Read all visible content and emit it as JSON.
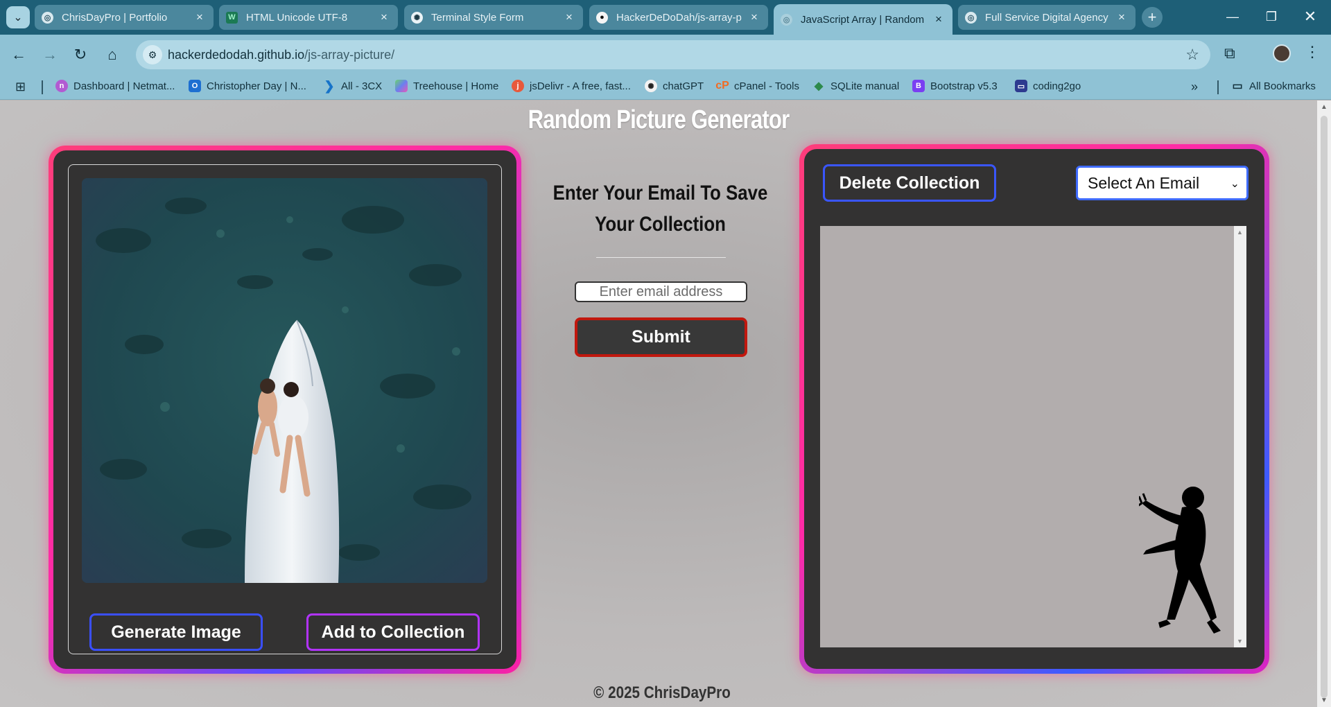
{
  "browser": {
    "tabs": [
      {
        "title": "ChrisDayPro | Portfolio",
        "active": false
      },
      {
        "title": "HTML Unicode UTF-8",
        "active": false
      },
      {
        "title": "Terminal Style Form",
        "active": false
      },
      {
        "title": "HackerDeDoDah/js-array-p",
        "active": false
      },
      {
        "title": "JavaScript Array | Random",
        "active": true
      },
      {
        "title": "Full Service Digital Agency",
        "active": false
      }
    ],
    "url_host": "hackerdedodah.github.io",
    "url_path": "/js-array-picture/",
    "bookmarks": [
      {
        "label": "Dashboard | Netmat...",
        "icon": "netmat-icon"
      },
      {
        "label": "Christopher Day | N...",
        "icon": "outlook-icon"
      },
      {
        "label": "All - 3CX",
        "icon": "3cx-icon"
      },
      {
        "label": "Treehouse | Home",
        "icon": "treehouse-icon"
      },
      {
        "label": "jsDelivr - A free, fast...",
        "icon": "jsdelivr-icon"
      },
      {
        "label": "chatGPT",
        "icon": "chatgpt-icon"
      },
      {
        "label": "cPanel - Tools",
        "icon": "cpanel-icon"
      },
      {
        "label": "SQLite manual",
        "icon": "sqlite-icon"
      },
      {
        "label": "Bootstrap v5.3",
        "icon": "bootstrap-icon"
      },
      {
        "label": "coding2go",
        "icon": "coding2go-icon"
      }
    ],
    "all_bookmarks": "All Bookmarks",
    "colors": {
      "tabbar": "#1e5f77",
      "toolbar": "#8fc2d5"
    }
  },
  "page": {
    "title": "Random Picture Generator",
    "generate_button": "Generate Image",
    "add_button": "Add to Collection",
    "email_heading": "Enter Your Email To Save Your Collection",
    "email_placeholder": "Enter email address",
    "submit_button": "Submit",
    "delete_button": "Delete Collection",
    "select_label": "Select An Email",
    "footer": "© 2025 ChrisDayPro",
    "colors": {
      "panel_bg": "#333232",
      "accent_blue": "#3a4fff",
      "accent_purple": "#b233ff",
      "submit_border": "#c1180e",
      "glow_pink": "#ff2aa8"
    }
  }
}
